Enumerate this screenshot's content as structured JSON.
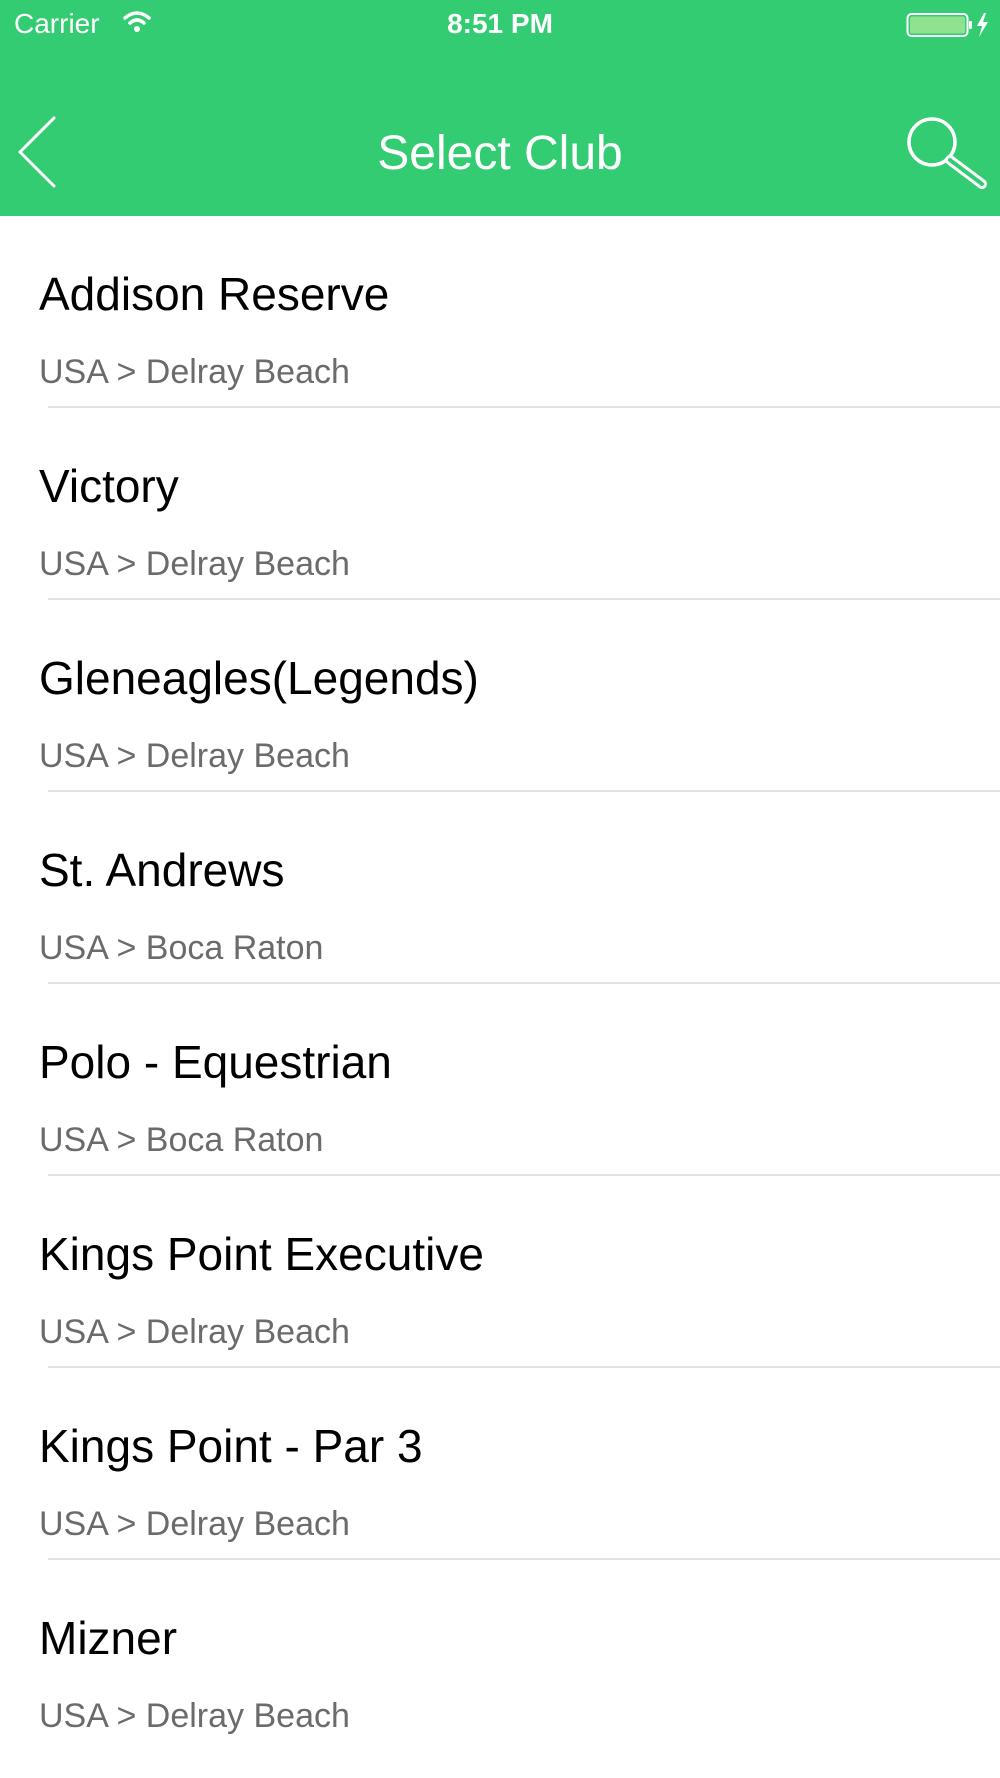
{
  "status_bar": {
    "carrier": "Carrier",
    "time": "8:51 PM"
  },
  "nav": {
    "title": "Select Club",
    "back_icon": "chevron-left-icon",
    "search_icon": "search-icon"
  },
  "colors": {
    "header": "#33cc72",
    "primary_text": "#000000",
    "secondary_text": "#6b6b6b",
    "divider": "#e2e2e2"
  },
  "clubs": [
    {
      "name": "Addison Reserve",
      "location": "USA > Delray Beach"
    },
    {
      "name": "Victory",
      "location": "USA > Delray Beach"
    },
    {
      "name": "Gleneagles(Legends)",
      "location": "USA > Delray Beach"
    },
    {
      "name": "St. Andrews",
      "location": "USA > Boca Raton"
    },
    {
      "name": "Polo - Equestrian",
      "location": "USA > Boca Raton"
    },
    {
      "name": "Kings Point Executive",
      "location": "USA > Delray Beach"
    },
    {
      "name": "Kings Point - Par 3",
      "location": "USA > Delray Beach"
    },
    {
      "name": "Mizner",
      "location": "USA > Delray Beach"
    }
  ]
}
